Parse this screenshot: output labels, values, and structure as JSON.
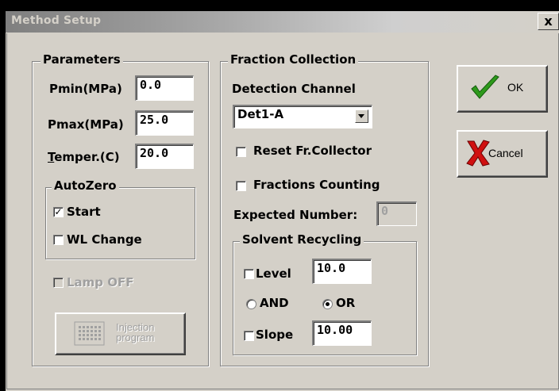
{
  "window": {
    "title": "Method Setup",
    "close_label": "x"
  },
  "parameters": {
    "legend": "Parameters",
    "pmin_label": "Pmin(MPa)",
    "pmin_value": "0.0",
    "pmax_label": "Pmax(MPa)",
    "pmax_value": "25.0",
    "temper_label_u": "T",
    "temper_label_rest": "emper.(C)",
    "temper_value": "20.0"
  },
  "autozero": {
    "legend": "AutoZero",
    "start_label": "Start",
    "start_checked": true,
    "wl_label": "WL Change",
    "wl_checked": false
  },
  "lamp_off_label": "Lamp OFF",
  "injection_button": {
    "line1": "Injection",
    "line2": "program"
  },
  "fraction": {
    "legend": "Fraction Collection",
    "channel_label": "Detection Channel",
    "channel_value": "Det1-A",
    "reset_label": "Reset Fr.Collector",
    "counting_label": "Fractions Counting",
    "expected_label": "Expected Number:",
    "expected_value": "0"
  },
  "solvent": {
    "legend": "Solvent Recycling",
    "level_label": "Level",
    "level_value": "10.0",
    "and_label": "AND",
    "or_label": "OR",
    "selected": "OR",
    "slope_label": "Slope",
    "slope_value": "10.00"
  },
  "buttons": {
    "ok_label": "OK",
    "cancel_label": "Cancel"
  },
  "colors": {
    "window_bg": "#d4d0c8",
    "check_green": "#2e9a1c",
    "cross_red": "#d01010"
  }
}
